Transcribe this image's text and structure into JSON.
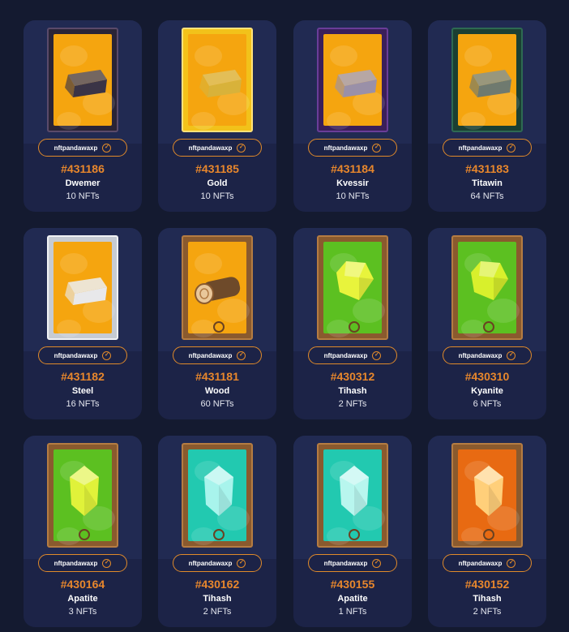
{
  "cards": [
    {
      "id": "#431186",
      "name": "Dwemer",
      "count": "10 NFTs",
      "owner": "nftpandawaxp",
      "frame": "stone",
      "bg": "#f5a50f",
      "item": "ingot",
      "itemColor": "#3a3446"
    },
    {
      "id": "#431185",
      "name": "Gold",
      "count": "10 NFTs",
      "owner": "nftpandawaxp",
      "frame": "gold",
      "bg": "#f5a50f",
      "item": "ingot",
      "itemColor": "#d8b23a"
    },
    {
      "id": "#431184",
      "name": "Kvessir",
      "count": "10 NFTs",
      "owner": "nftpandawaxp",
      "frame": "purple",
      "bg": "#f5a50f",
      "item": "ingot",
      "itemColor": "#9a90a8"
    },
    {
      "id": "#431183",
      "name": "Titawin",
      "count": "64 NFTs",
      "owner": "nftpandawaxp",
      "frame": "green",
      "bg": "#f5a50f",
      "item": "ingot",
      "itemColor": "#6f7a6f"
    },
    {
      "id": "#431182",
      "name": "Steel",
      "count": "16 NFTs",
      "owner": "nftpandawaxp",
      "frame": "steel",
      "bg": "#f5a50f",
      "item": "ingot",
      "itemColor": "#e8e8ea"
    },
    {
      "id": "#431181",
      "name": "Wood",
      "count": "60 NFTs",
      "owner": "nftpandawaxp",
      "frame": "wood",
      "bg": "#f5a50f",
      "item": "log",
      "itemColor": "#6e4a2a"
    },
    {
      "id": "#430312",
      "name": "Tihash",
      "count": "2 NFTs",
      "owner": "nftpandawaxp",
      "frame": "wood",
      "bg": "#5cc021",
      "item": "gem",
      "itemColor": "#e8f43c"
    },
    {
      "id": "#430310",
      "name": "Kyanite",
      "count": "6 NFTs",
      "owner": "nftpandawaxp",
      "frame": "wood",
      "bg": "#5cc021",
      "item": "gem",
      "itemColor": "#d8f02c"
    },
    {
      "id": "#430164",
      "name": "Apatite",
      "count": "3 NFTs",
      "owner": "nftpandawaxp",
      "frame": "wood",
      "bg": "#5cc021",
      "item": "crystal",
      "itemColor": "#e0f23a"
    },
    {
      "id": "#430162",
      "name": "Tihash",
      "count": "2 NFTs",
      "owner": "nftpandawaxp",
      "frame": "wood",
      "bg": "#22c9b0",
      "item": "crystal",
      "itemColor": "#a8f4ec"
    },
    {
      "id": "#430155",
      "name": "Apatite",
      "count": "1 NFTs",
      "owner": "nftpandawaxp",
      "frame": "wood",
      "bg": "#22c9b0",
      "item": "crystal",
      "itemColor": "#b8f6ee"
    },
    {
      "id": "#430152",
      "name": "Tihash",
      "count": "2 NFTs",
      "owner": "nftpandawaxp",
      "frame": "wood",
      "bg": "#e86a12",
      "item": "crystal",
      "itemColor": "#ffcf7a"
    }
  ],
  "colors": {
    "accent": "#e8872c",
    "card": "#1c2347",
    "page": "#141a30"
  },
  "icons": {
    "verified": "check-circle-icon"
  }
}
